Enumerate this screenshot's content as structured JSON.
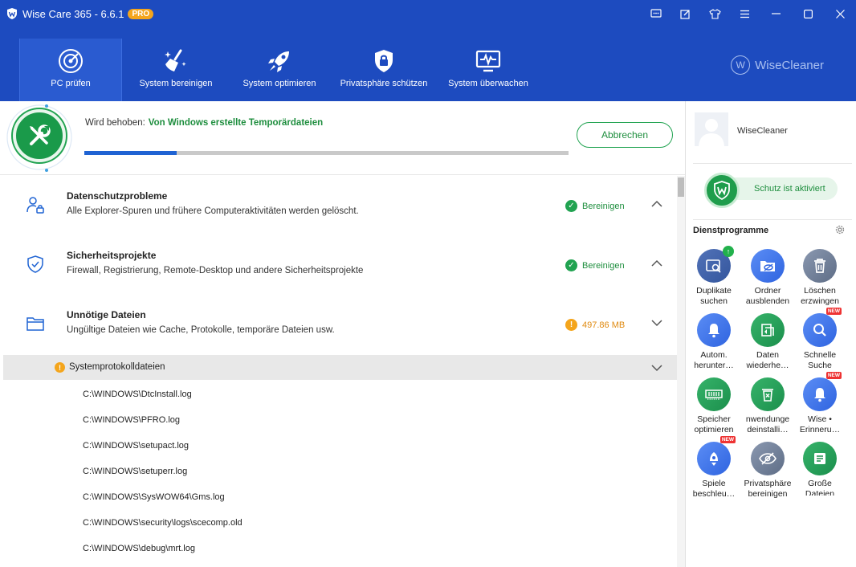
{
  "window": {
    "title": "Wise Care 365 - 6.6.1",
    "badge": "PRO"
  },
  "nav": {
    "items": [
      {
        "label": "PC prüfen",
        "icon": "radar-icon"
      },
      {
        "label": "System bereinigen",
        "icon": "broom-icon"
      },
      {
        "label": "System optimieren",
        "icon": "rocket-icon"
      },
      {
        "label": "Privatsphäre schützen",
        "icon": "lock-shield-icon"
      },
      {
        "label": "System überwachen",
        "icon": "monitor-pulse-icon"
      }
    ],
    "brand": "WiseCleaner"
  },
  "progress": {
    "label": "Wird behoben:",
    "value": "Von Windows erstellte Temporärdateien",
    "percent": 19,
    "cancel_label": "Abbrechen"
  },
  "categories": [
    {
      "title": "Datenschutzprobleme",
      "desc": "Alle Explorer-Spuren und frühere Computeraktivitäten werden gelöscht.",
      "status": "Bereinigen",
      "status_kind": "ok"
    },
    {
      "title": "Sicherheitsprojekte",
      "desc": "Firewall, Registrierung, Remote-Desktop und andere Sicherheitsprojekte",
      "status": "Bereinigen",
      "status_kind": "ok"
    },
    {
      "title": "Unnötige Dateien",
      "desc": "Ungültige Dateien wie Cache, Protokolle, temporäre Dateien usw.",
      "status": "497.86 MB",
      "status_kind": "warn"
    }
  ],
  "subgroup": {
    "title": "Systemprotokolldateien"
  },
  "files": [
    "C:\\WINDOWS\\DtcInstall.log",
    "C:\\WINDOWS\\PFRO.log",
    "C:\\WINDOWS\\setupact.log",
    "C:\\WINDOWS\\setuperr.log",
    "C:\\WINDOWS\\SysWOW64\\Gms.log",
    "C:\\WINDOWS\\security\\logs\\scecomp.old",
    "C:\\WINDOWS\\debug\\mrt.log"
  ],
  "side": {
    "username": "WiseCleaner",
    "protection": "Schutz ist aktiviert",
    "tools_title": "Dienstprogramme",
    "tools": [
      {
        "line1": "Duplikate",
        "line2": "suchen"
      },
      {
        "line1": "Ordner",
        "line2": "ausblenden"
      },
      {
        "line1": "Löschen",
        "line2": "erzwingen"
      },
      {
        "line1": "Autom.",
        "line2": "herunter…"
      },
      {
        "line1": "Daten",
        "line2": "wiederhe…"
      },
      {
        "line1": "Schnelle",
        "line2": "Suche"
      },
      {
        "line1": "Speicher",
        "line2": "optimieren"
      },
      {
        "line1": "nwendunge",
        "line2": "deinstalli…"
      },
      {
        "line1": "Wise •",
        "line2": "Erinneru…"
      },
      {
        "line1": "Spiele",
        "line2": "beschleu…"
      },
      {
        "line1": "Privatsphäre",
        "line2": "bereinigen"
      },
      {
        "line1": "Große",
        "line2": "Dateien"
      }
    ],
    "new_badge": "NEW"
  },
  "colors": {
    "header": "#1d4bbf",
    "accent_green": "#1e8e3e",
    "warn_orange": "#f4a51c",
    "progress_blue": "#1f63d3"
  }
}
